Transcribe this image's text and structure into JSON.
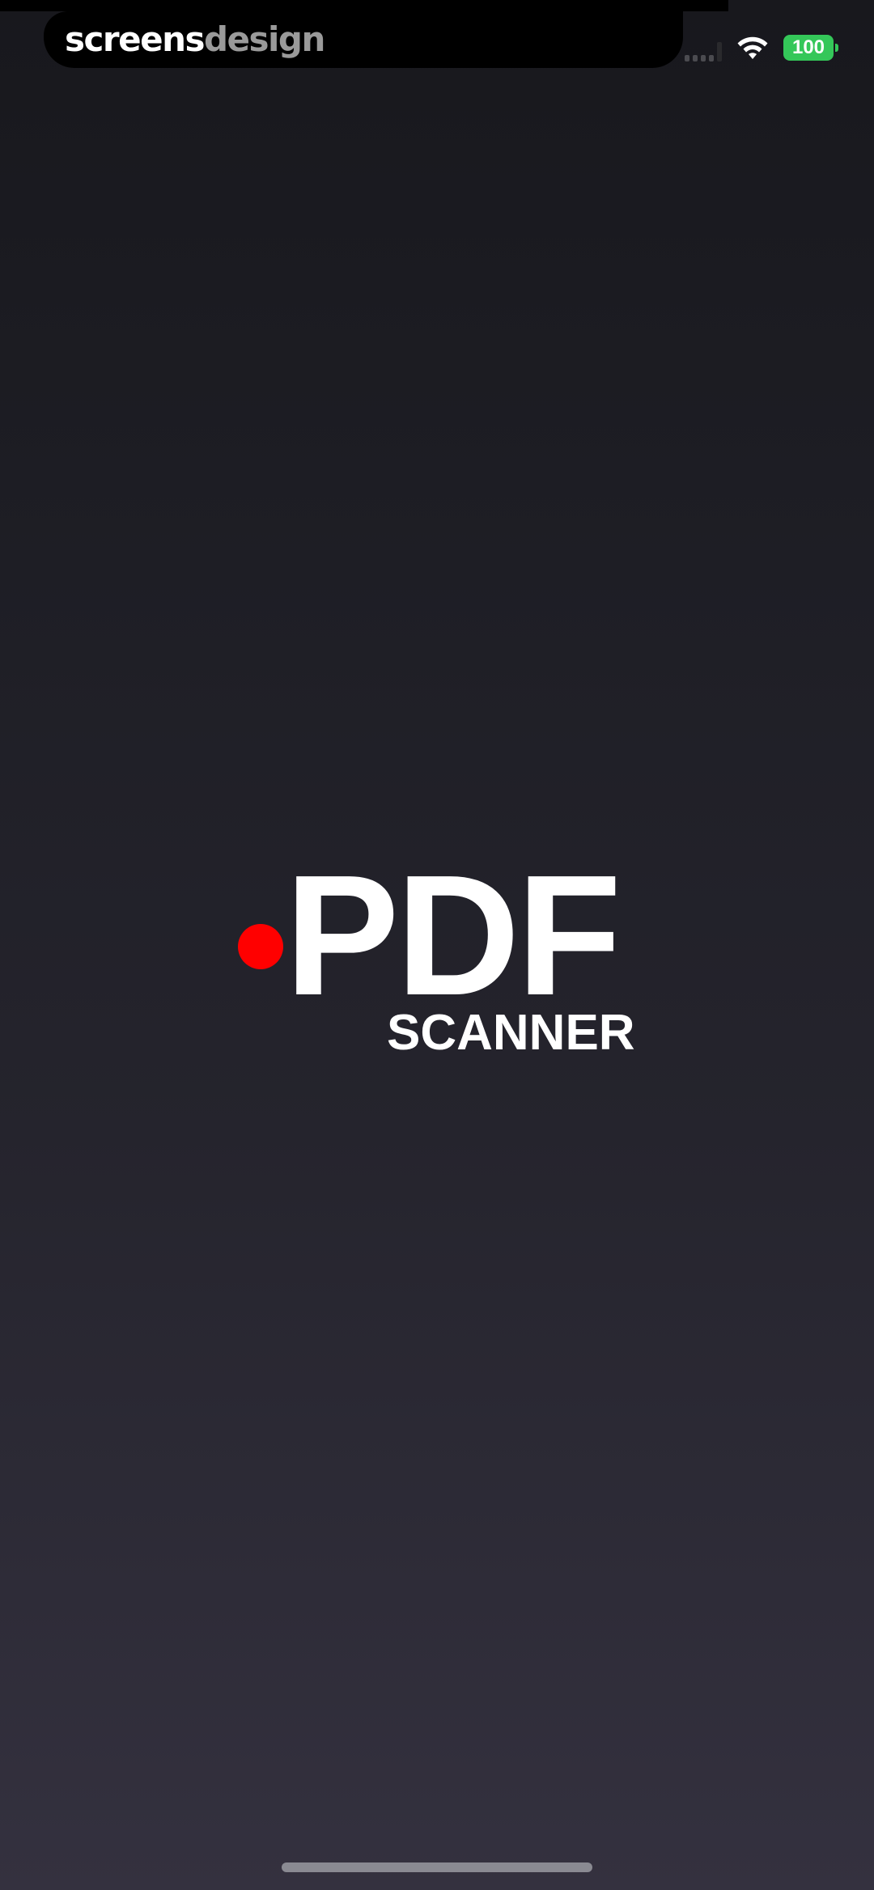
{
  "watermark": {
    "part1": "screens",
    "part2": "design"
  },
  "status_bar": {
    "signal_icon": "cellular-signal-icon",
    "wifi_icon": "wifi-icon",
    "battery_level": "100",
    "battery_color": "#34c759"
  },
  "logo": {
    "dot_color": "#ff0000",
    "title": "PDF",
    "subtitle": "SCANNER"
  },
  "home_indicator": {
    "icon": "home-indicator-bar"
  }
}
